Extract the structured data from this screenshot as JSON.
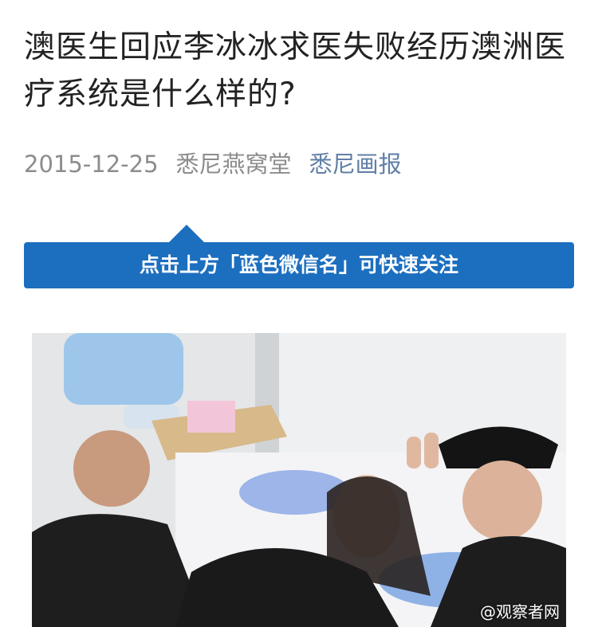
{
  "article": {
    "title": "澳医生回应李冰冰求医失败经历澳洲医疗系统是什么样的?",
    "date": "2015-12-25",
    "author": "悉尼燕窝堂",
    "account": "悉尼画报"
  },
  "banner": {
    "text": "点击上方「蓝色微信名」可快速关注"
  },
  "photo": {
    "watermark": "@观察者网"
  },
  "colors": {
    "banner_bg": "#1c6fbf",
    "account_link": "#607fa6",
    "meta_gray": "#8c8c8c"
  }
}
